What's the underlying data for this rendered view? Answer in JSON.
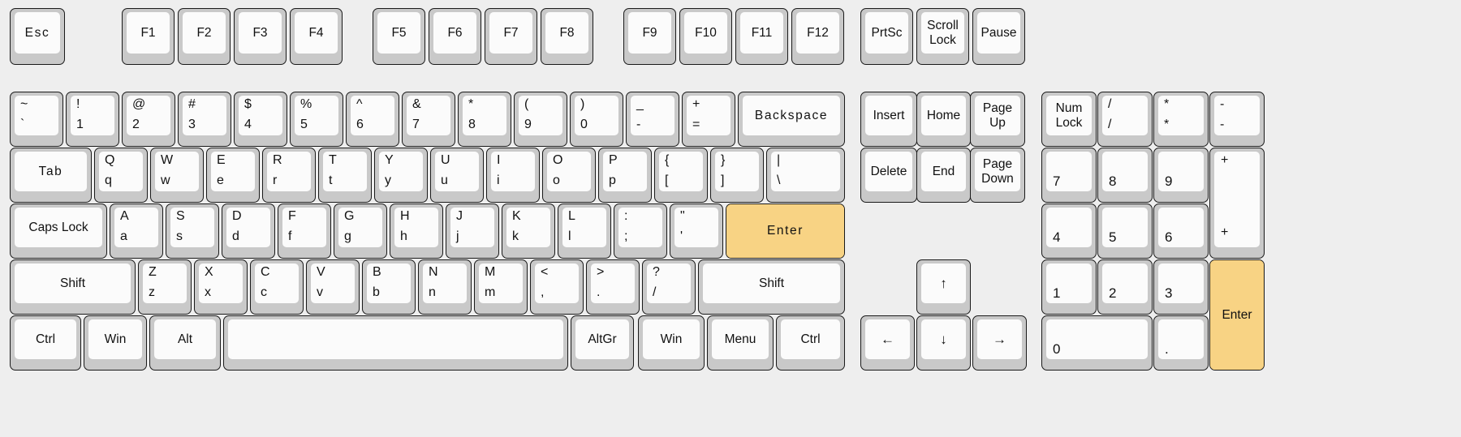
{
  "title": "On-screen keyboard layout",
  "colors": {
    "background": "#eeeeee",
    "key_body": "#c9c9c9",
    "key_cap": "#fbfbfb",
    "key_border": "#1a1a1a",
    "highlight": "#f8d384",
    "text": "#111111"
  },
  "highlighted_keys": [
    "Enter",
    "Numpad Enter"
  ],
  "clusters": {
    "function_row": "Esc and F1-F12 plus PrtSc, Scroll Lock, Pause",
    "main_block": "Typewriter keys, 5 rows",
    "nav_cluster": "Insert/Home/Page Up, Delete/End/Page Down, arrow keys",
    "numpad": "Num Lock through numpad Enter"
  },
  "keys": {
    "esc": {
      "label": "Esc"
    },
    "f1": {
      "label": "F1"
    },
    "f2": {
      "label": "F2"
    },
    "f3": {
      "label": "F3"
    },
    "f4": {
      "label": "F4"
    },
    "f5": {
      "label": "F5"
    },
    "f6": {
      "label": "F6"
    },
    "f7": {
      "label": "F7"
    },
    "f8": {
      "label": "F8"
    },
    "f9": {
      "label": "F9"
    },
    "f10": {
      "label": "F10"
    },
    "f11": {
      "label": "F11"
    },
    "f12": {
      "label": "F12"
    },
    "prtsc": {
      "label": "PrtSc"
    },
    "scrolllock": {
      "label": "Scroll\nLock"
    },
    "pause": {
      "label": "Pause"
    },
    "backtick": {
      "top": "~",
      "bottom": "`"
    },
    "one": {
      "top": "!",
      "bottom": "1"
    },
    "two": {
      "top": "@",
      "bottom": "2"
    },
    "three": {
      "top": "#",
      "bottom": "3"
    },
    "four": {
      "top": "$",
      "bottom": "4"
    },
    "five": {
      "top": "%",
      "bottom": "5"
    },
    "six": {
      "top": "^",
      "bottom": "6"
    },
    "seven": {
      "top": "&",
      "bottom": "7"
    },
    "eight": {
      "top": "*",
      "bottom": "8"
    },
    "nine": {
      "top": "(",
      "bottom": "9"
    },
    "zero": {
      "top": ")",
      "bottom": "0"
    },
    "minus": {
      "top": "_",
      "bottom": "-"
    },
    "equal": {
      "top": "+",
      "bottom": "="
    },
    "backspace": {
      "label": "Backspace"
    },
    "tab": {
      "label": "Tab"
    },
    "q": {
      "top": "Q",
      "bottom": "q"
    },
    "w": {
      "top": "W",
      "bottom": "w"
    },
    "e": {
      "top": "E",
      "bottom": "e"
    },
    "r": {
      "top": "R",
      "bottom": "r"
    },
    "t": {
      "top": "T",
      "bottom": "t"
    },
    "y": {
      "top": "Y",
      "bottom": "y"
    },
    "u": {
      "top": "U",
      "bottom": "u"
    },
    "i": {
      "top": "I",
      "bottom": "i"
    },
    "o": {
      "top": "O",
      "bottom": "o"
    },
    "p": {
      "top": "P",
      "bottom": "p"
    },
    "lbracket": {
      "top": "{",
      "bottom": "["
    },
    "rbracket": {
      "top": "}",
      "bottom": "]"
    },
    "backslash": {
      "top": "|",
      "bottom": "\\"
    },
    "capslock": {
      "label": "Caps Lock"
    },
    "a": {
      "top": "A",
      "bottom": "a"
    },
    "s": {
      "top": "S",
      "bottom": "s"
    },
    "d": {
      "top": "D",
      "bottom": "d"
    },
    "f": {
      "top": "F",
      "bottom": "f"
    },
    "g": {
      "top": "G",
      "bottom": "g"
    },
    "h": {
      "top": "H",
      "bottom": "h"
    },
    "j": {
      "top": "J",
      "bottom": "j"
    },
    "k": {
      "top": "K",
      "bottom": "k"
    },
    "l": {
      "top": "L",
      "bottom": "l"
    },
    "semicolon": {
      "top": ":",
      "bottom": ";"
    },
    "quote": {
      "top": "\"",
      "bottom": "'"
    },
    "enter": {
      "label": "Enter",
      "highlighted": true
    },
    "lshift": {
      "label": "Shift"
    },
    "z": {
      "top": "Z",
      "bottom": "z"
    },
    "x": {
      "top": "X",
      "bottom": "x"
    },
    "c": {
      "top": "C",
      "bottom": "c"
    },
    "v": {
      "top": "V",
      "bottom": "v"
    },
    "b": {
      "top": "B",
      "bottom": "b"
    },
    "n": {
      "top": "N",
      "bottom": "n"
    },
    "m": {
      "top": "M",
      "bottom": "m"
    },
    "comma": {
      "top": "<",
      "bottom": ","
    },
    "period": {
      "top": ">",
      "bottom": "."
    },
    "slash": {
      "top": "?",
      "bottom": "/"
    },
    "rshift": {
      "label": "Shift"
    },
    "lctrl": {
      "label": "Ctrl"
    },
    "lwin": {
      "label": "Win"
    },
    "lalt": {
      "label": "Alt"
    },
    "space": {
      "label": ""
    },
    "altgr": {
      "label": "AltGr"
    },
    "rwin": {
      "label": "Win"
    },
    "menu": {
      "label": "Menu"
    },
    "rctrl": {
      "label": "Ctrl"
    },
    "insert": {
      "label": "Insert"
    },
    "home": {
      "label": "Home"
    },
    "pageup": {
      "label": "Page\nUp"
    },
    "delete": {
      "label": "Delete"
    },
    "end": {
      "label": "End"
    },
    "pagedown": {
      "label": "Page\nDown"
    },
    "up": {
      "label": "↑"
    },
    "left": {
      "label": "←"
    },
    "down": {
      "label": "↓"
    },
    "right": {
      "label": "→"
    },
    "numlock": {
      "label": "Num\nLock"
    },
    "numdivide": {
      "top": "/",
      "bottom": "/"
    },
    "nummultiply": {
      "top": "*",
      "bottom": "*"
    },
    "numminus": {
      "top": "-",
      "bottom": "-"
    },
    "num7": {
      "label": "7"
    },
    "num8": {
      "label": "8"
    },
    "num9": {
      "label": "9"
    },
    "numplus": {
      "top": "+",
      "bottom": "+"
    },
    "num4": {
      "label": "4"
    },
    "num5": {
      "label": "5"
    },
    "num6": {
      "label": "6"
    },
    "num1": {
      "label": "1"
    },
    "num2": {
      "label": "2"
    },
    "num3": {
      "label": "3"
    },
    "num0": {
      "label": "0"
    },
    "numperiod": {
      "label": "."
    },
    "numenter": {
      "label": "Enter",
      "highlighted": true
    }
  }
}
